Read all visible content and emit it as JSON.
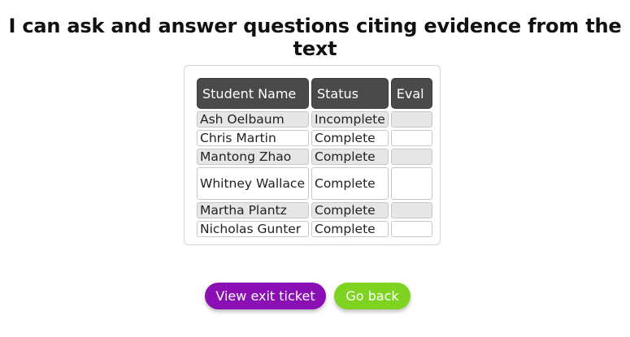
{
  "page": {
    "title": "I can ask and answer questions citing evidence from the text"
  },
  "table": {
    "headers": {
      "name": "Student Name",
      "status": "Status",
      "eval": "Eval"
    },
    "rows": [
      {
        "name": "Ash Oelbaum",
        "status": "Incomplete",
        "eval": ""
      },
      {
        "name": "Chris Martin",
        "status": "Complete",
        "eval": ""
      },
      {
        "name": "Mantong Zhao",
        "status": "Complete",
        "eval": ""
      },
      {
        "name": "Whitney Wallace",
        "status": "Complete",
        "eval": ""
      },
      {
        "name": "Martha Plantz",
        "status": "Complete",
        "eval": ""
      },
      {
        "name": "Nicholas Gunter",
        "status": "Complete",
        "eval": ""
      }
    ]
  },
  "actions": {
    "view_exit_ticket": "View exit ticket",
    "go_back": "Go back"
  },
  "colors": {
    "view_button": "#8a0fb5",
    "back_button": "#7ed321",
    "header_bg": "#4a4a4a"
  }
}
